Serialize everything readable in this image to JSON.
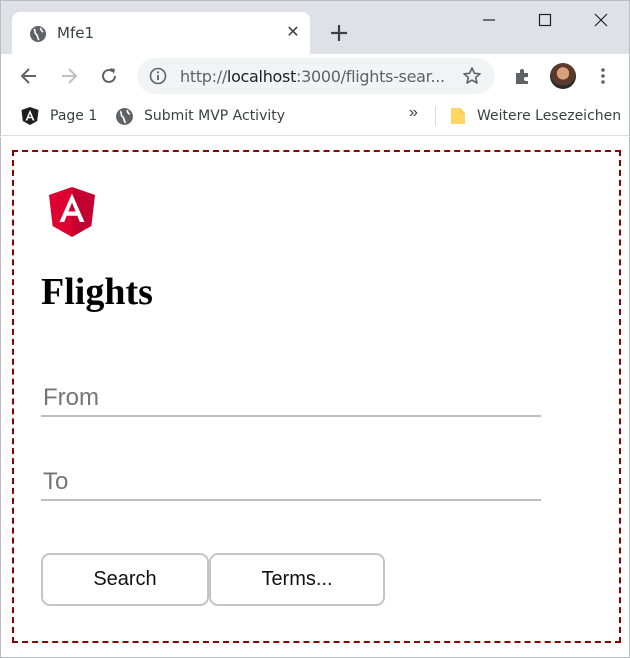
{
  "browser": {
    "tab": {
      "title": "Mfe1",
      "close_glyph": "✕",
      "icon": "globe-icon"
    },
    "address_bar": {
      "url_prefix": "http://",
      "url_host": "localhost",
      "url_rest": ":3000/flights-sear..."
    },
    "bookmarks": {
      "items": [
        {
          "label": "Page 1",
          "icon": "angular-icon"
        },
        {
          "label": "Submit MVP Activity",
          "icon": "globe-icon"
        }
      ],
      "overflow": "»",
      "other": {
        "label": "Weitere Lesezeichen",
        "icon": "folder-icon"
      }
    }
  },
  "page": {
    "logo": {
      "letter": "A",
      "colors": {
        "left": "#dd0031",
        "right": "#c3002f",
        "letter": "#ffffff"
      }
    },
    "title": "Flights",
    "from": {
      "placeholder": "From",
      "value": ""
    },
    "to": {
      "placeholder": "To",
      "value": ""
    },
    "buttons": {
      "search": "Search",
      "terms": "Terms..."
    },
    "colors": {
      "frame_border": "#8b0000"
    }
  }
}
